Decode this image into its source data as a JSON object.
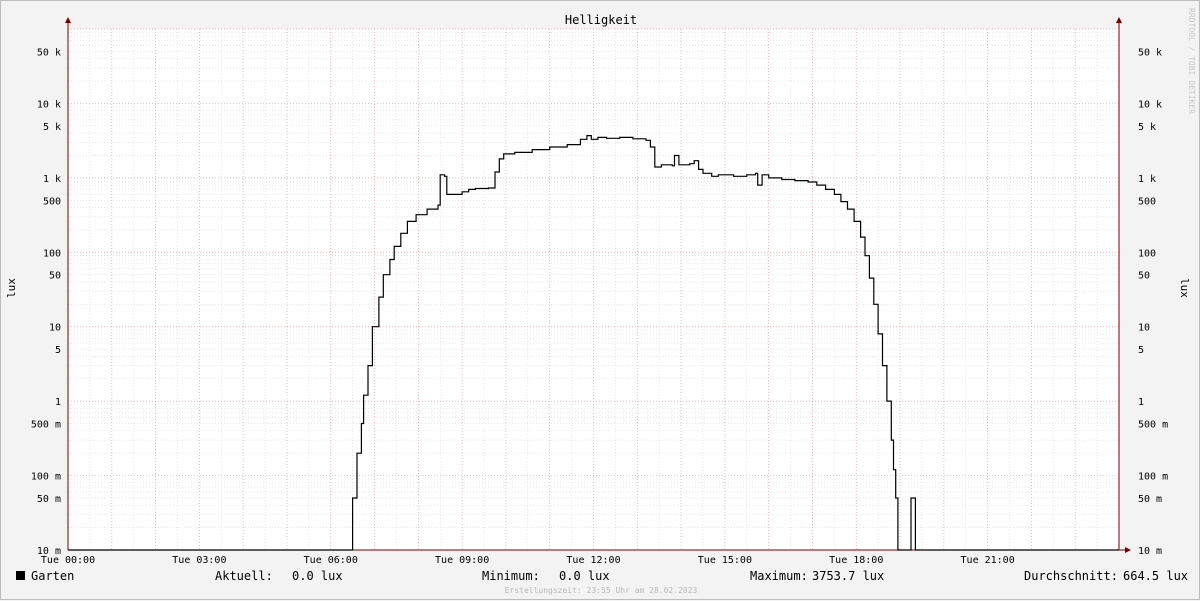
{
  "chart_data": {
    "type": "line",
    "title": "Helligkeit",
    "ylabel": "lux",
    "ylabel_right": "lux",
    "y_scale": "log",
    "ylim": [
      0.01,
      100000
    ],
    "xlim": [
      0,
      24
    ],
    "grid": true,
    "y_ticks": [
      {
        "value": 50000,
        "label": "50 k"
      },
      {
        "value": 10000,
        "label": "10 k"
      },
      {
        "value": 5000,
        "label": "5 k"
      },
      {
        "value": 1000,
        "label": "1 k"
      },
      {
        "value": 500,
        "label": "500"
      },
      {
        "value": 100,
        "label": "100"
      },
      {
        "value": 50,
        "label": "50"
      },
      {
        "value": 10,
        "label": "10"
      },
      {
        "value": 5,
        "label": "5"
      },
      {
        "value": 1,
        "label": "1"
      },
      {
        "value": 0.5,
        "label": "500 m"
      },
      {
        "value": 0.1,
        "label": "100 m"
      },
      {
        "value": 0.05,
        "label": "50 m"
      },
      {
        "value": 0.01,
        "label": "10 m"
      }
    ],
    "x_ticks": [
      {
        "value": 0,
        "label": "Tue 00:00"
      },
      {
        "value": 3,
        "label": "Tue 03:00"
      },
      {
        "value": 6,
        "label": "Tue 06:00"
      },
      {
        "value": 9,
        "label": "Tue 09:00"
      },
      {
        "value": 12,
        "label": "Tue 12:00"
      },
      {
        "value": 15,
        "label": "Tue 15:00"
      },
      {
        "value": 18,
        "label": "Tue 18:00"
      },
      {
        "value": 21,
        "label": "Tue 21:00"
      }
    ],
    "series": [
      {
        "name": "Garten",
        "color": "#000000",
        "points": [
          [
            0,
            0.01
          ],
          [
            6.45,
            0.01
          ],
          [
            6.5,
            0.05
          ],
          [
            6.6,
            0.2
          ],
          [
            6.7,
            0.5
          ],
          [
            6.75,
            1.2
          ],
          [
            6.85,
            3
          ],
          [
            6.95,
            10
          ],
          [
            7.1,
            25
          ],
          [
            7.2,
            50
          ],
          [
            7.35,
            80
          ],
          [
            7.45,
            120
          ],
          [
            7.6,
            180
          ],
          [
            7.75,
            260
          ],
          [
            7.95,
            320
          ],
          [
            8.2,
            380
          ],
          [
            8.45,
            430
          ],
          [
            8.5,
            1100
          ],
          [
            8.6,
            1050
          ],
          [
            8.65,
            600
          ],
          [
            8.9,
            600
          ],
          [
            9.0,
            650
          ],
          [
            9.15,
            700
          ],
          [
            9.3,
            720
          ],
          [
            9.6,
            730
          ],
          [
            9.75,
            1200
          ],
          [
            9.85,
            1800
          ],
          [
            9.95,
            2100
          ],
          [
            10.2,
            2200
          ],
          [
            10.6,
            2400
          ],
          [
            11.0,
            2600
          ],
          [
            11.4,
            2800
          ],
          [
            11.7,
            3300
          ],
          [
            11.85,
            3700
          ],
          [
            11.95,
            3300
          ],
          [
            12.1,
            3500
          ],
          [
            12.3,
            3400
          ],
          [
            12.6,
            3500
          ],
          [
            12.9,
            3350
          ],
          [
            13.2,
            3200
          ],
          [
            13.3,
            2600
          ],
          [
            13.4,
            1400
          ],
          [
            13.55,
            1500
          ],
          [
            13.8,
            1450
          ],
          [
            13.85,
            2000
          ],
          [
            13.95,
            1500
          ],
          [
            14.2,
            1550
          ],
          [
            14.3,
            1700
          ],
          [
            14.4,
            1300
          ],
          [
            14.5,
            1150
          ],
          [
            14.7,
            1050
          ],
          [
            14.85,
            1100
          ],
          [
            15.2,
            1050
          ],
          [
            15.5,
            1100
          ],
          [
            15.7,
            1150
          ],
          [
            15.75,
            800
          ],
          [
            15.85,
            1100
          ],
          [
            16.0,
            1000
          ],
          [
            16.3,
            950
          ],
          [
            16.6,
            920
          ],
          [
            16.9,
            880
          ],
          [
            17.1,
            800
          ],
          [
            17.3,
            700
          ],
          [
            17.5,
            600
          ],
          [
            17.65,
            480
          ],
          [
            17.8,
            380
          ],
          [
            17.95,
            260
          ],
          [
            18.1,
            160
          ],
          [
            18.2,
            90
          ],
          [
            18.3,
            45
          ],
          [
            18.4,
            20
          ],
          [
            18.5,
            8
          ],
          [
            18.6,
            3
          ],
          [
            18.7,
            1
          ],
          [
            18.8,
            0.3
          ],
          [
            18.85,
            0.12
          ],
          [
            18.9,
            0.05
          ],
          [
            18.95,
            0.01
          ],
          [
            19.2,
            0.01
          ],
          [
            19.25,
            0.05
          ],
          [
            19.3,
            0.05
          ],
          [
            19.35,
            0.01
          ],
          [
            24,
            0.01
          ]
        ]
      }
    ]
  },
  "legend": {
    "series_name": "Garten",
    "current_label": "Aktuell:",
    "current_value": "0.0 lux",
    "min_label": "Minimum:",
    "min_value": "0.0 lux",
    "max_label": "Maximum:",
    "max_value": "3753.7 lux",
    "avg_label": "Durchschnitt:",
    "avg_value": "664.5 lux"
  },
  "watermark": "RRDTOOL / TOBI OETIKER",
  "footer": "Erstellungszeit: 23:55 Uhr am 28.02.2023",
  "colors": {
    "background": "#f3f3f3",
    "plot_background": "#ffffff",
    "major_grid": "#e8a0a0",
    "minor_grid": "#d8d8d8",
    "axis": "#7a0000",
    "line": "#000000"
  }
}
